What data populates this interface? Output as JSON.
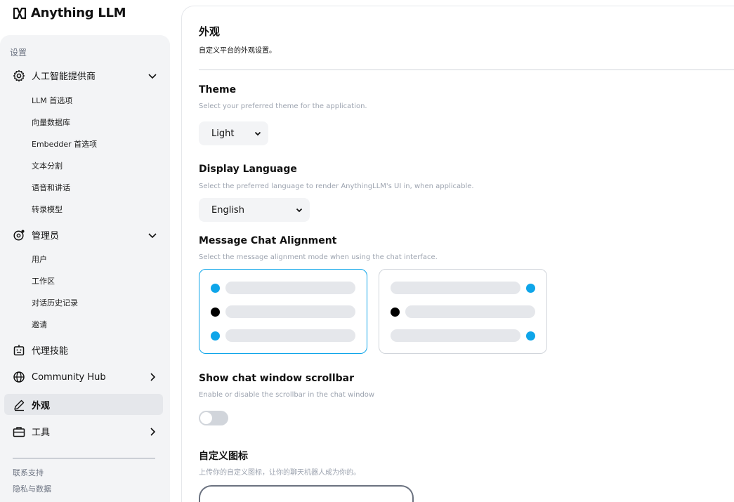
{
  "app": {
    "name": "Anything LLM"
  },
  "sidebar": {
    "section_label": "设置",
    "groups": [
      {
        "label": "人工智能提供商",
        "icon": "gear-icon",
        "expanded": true,
        "items": [
          "LLM 首选项",
          "向量数据库",
          "Embedder 首选项",
          "文本分割",
          "语音和讲话",
          "转录模型"
        ]
      },
      {
        "label": "管理员",
        "icon": "admin-gear-icon",
        "expanded": true,
        "items": [
          "用户",
          "工作区",
          "对话历史记录",
          "邀请"
        ]
      },
      {
        "label": "代理技能",
        "icon": "robot-icon"
      },
      {
        "label": "Community Hub",
        "icon": "globe-icon"
      },
      {
        "label": "外观",
        "icon": "pencil-icon",
        "active": true
      },
      {
        "label": "工具",
        "icon": "toolbox-icon"
      }
    ],
    "footer": [
      "联系支持",
      "隐私与数据"
    ]
  },
  "main": {
    "title": "外观",
    "description": "自定义平台的外观设置。",
    "theme": {
      "title": "Theme",
      "description": "Select your preferred theme for the application.",
      "value": "Light"
    },
    "language": {
      "title": "Display Language",
      "description": "Select the preferred language to render AnythingLLM's UI in, when applicable.",
      "value": "English"
    },
    "alignment": {
      "title": "Message Chat Alignment",
      "description": "Select the message alignment mode when using the chat interface.",
      "selected": "left"
    },
    "scrollbar": {
      "title": "Show chat window scrollbar",
      "description": "Enable or disable the scrollbar in the chat window",
      "enabled": false
    },
    "custom_icon": {
      "title": "自定义图标",
      "description": "上传你的自定义图标，让你的聊天机器人成为你的。"
    }
  },
  "colors": {
    "accent": "#0ea5e9",
    "user_dot": "#0ea5e9",
    "bot_dot": "#000000"
  }
}
